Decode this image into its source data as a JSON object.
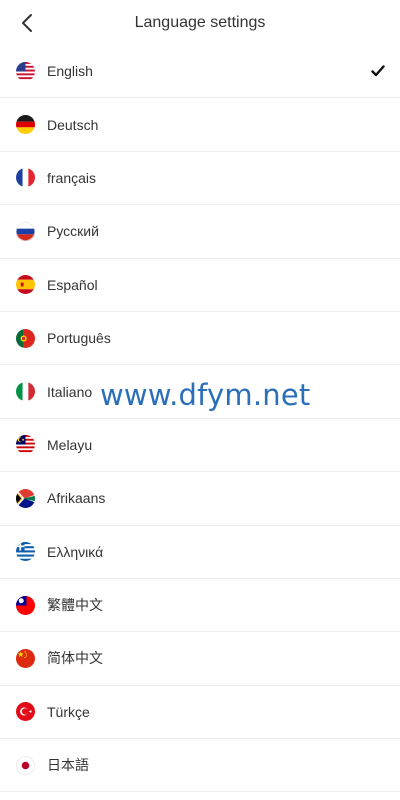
{
  "header": {
    "title": "Language settings"
  },
  "languages": [
    {
      "label": "English",
      "flag": "us-flag-icon",
      "selected": true
    },
    {
      "label": "Deutsch",
      "flag": "de-flag-icon",
      "selected": false
    },
    {
      "label": "français",
      "flag": "fr-flag-icon",
      "selected": false
    },
    {
      "label": "Русский",
      "flag": "ru-flag-icon",
      "selected": false
    },
    {
      "label": "Español",
      "flag": "es-flag-icon",
      "selected": false
    },
    {
      "label": "Português",
      "flag": "pt-flag-icon",
      "selected": false
    },
    {
      "label": "Italiano",
      "flag": "it-flag-icon",
      "selected": false
    },
    {
      "label": "Melayu",
      "flag": "my-flag-icon",
      "selected": false
    },
    {
      "label": "Afrikaans",
      "flag": "za-flag-icon",
      "selected": false
    },
    {
      "label": "Ελληνικά",
      "flag": "gr-flag-icon",
      "selected": false
    },
    {
      "label": "繁體中文",
      "flag": "tw-flag-icon",
      "selected": false
    },
    {
      "label": "简体中文",
      "flag": "cn-flag-icon",
      "selected": false
    },
    {
      "label": "Türkçe",
      "flag": "tr-flag-icon",
      "selected": false
    },
    {
      "label": "日本語",
      "flag": "jp-flag-icon",
      "selected": false
    }
  ],
  "watermark": "www.dfym.net",
  "colors": {
    "text": "#333333",
    "divider": "#ececec",
    "watermark": "#2a6fb8"
  }
}
